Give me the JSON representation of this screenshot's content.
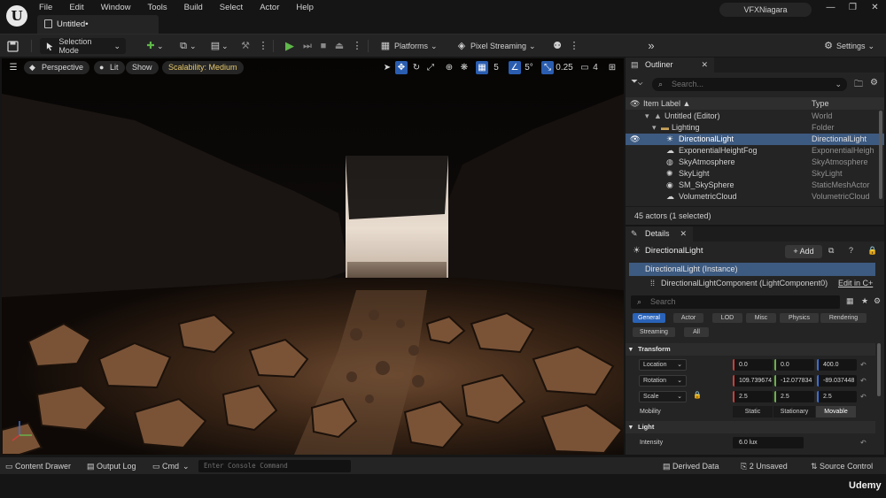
{
  "app": {
    "logo": "U",
    "menu": [
      "File",
      "Edit",
      "Window",
      "Tools",
      "Build",
      "Select",
      "Actor",
      "Help"
    ],
    "document_tab": "Untitled•",
    "project_name": "VFXNiagara",
    "window_controls": [
      "—",
      "❐",
      "✕"
    ]
  },
  "toolbar": {
    "save_icon": "save-icon",
    "selection_mode": "Selection Mode",
    "platforms": "Platforms",
    "pixel_streaming": "Pixel Streaming",
    "settings": "Settings"
  },
  "viewport": {
    "perspective": "Perspective",
    "lit": "Lit",
    "show": "Show",
    "scalability": "Scalability: Medium",
    "grid_snap": "5",
    "angle_snap": "5°",
    "scale_snap": "0.25",
    "camera_speed": "4"
  },
  "outliner": {
    "tab_label": "Outliner",
    "search_placeholder": "Search...",
    "col_label": "Item Label ▲",
    "col_type": "Type",
    "rows": [
      {
        "name": "Untitled (Editor)",
        "type": "World"
      },
      {
        "name": "Lighting",
        "type": "Folder"
      },
      {
        "name": "DirectionalLight",
        "type": "DirectionalLight"
      },
      {
        "name": "ExponentialHeightFog",
        "type": "ExponentialHeigh"
      },
      {
        "name": "SkyAtmosphere",
        "type": "SkyAtmosphere"
      },
      {
        "name": "SkyLight",
        "type": "SkyLight"
      },
      {
        "name": "SM_SkySphere",
        "type": "StaticMeshActor"
      },
      {
        "name": "VolumetricCloud",
        "type": "VolumetricCloud"
      }
    ],
    "status": "45 actors (1 selected)"
  },
  "details": {
    "tab_label": "Details",
    "actor_name": "DirectionalLight",
    "add_label": "+ Add",
    "instance": "DirectionalLight (Instance)",
    "component": "DirectionalLightComponent (LightComponent0)",
    "edit_cpp": "Edit in C+",
    "search_placeholder": "Search",
    "categories": [
      "General",
      "Actor",
      "LOD",
      "Misc",
      "Physics",
      "Rendering",
      "Streaming",
      "All"
    ],
    "transform_section": "Transform",
    "location_label": "Location",
    "location": [
      "0.0",
      "0.0",
      "400.0"
    ],
    "rotation_label": "Rotation",
    "rotation": [
      "109.739674",
      "-12.077834",
      "-89.037448"
    ],
    "scale_label": "Scale",
    "scale": [
      "2.5",
      "2.5",
      "2.5"
    ],
    "mobility_label": "Mobility",
    "mobility_options": [
      "Static",
      "Stationary",
      "Movable"
    ],
    "light_section": "Light",
    "intensity_label": "Intensity",
    "intensity": "6.0 lux"
  },
  "statusbar": {
    "content_drawer": "Content Drawer",
    "output_log": "Output Log",
    "cmd": "Cmd",
    "console_placeholder": "Enter Console Command",
    "derived_data": "Derived Data",
    "unsaved": "2 Unsaved",
    "source_control": "Source Control"
  },
  "watermark": "Udemy",
  "colors": {
    "selection_blue": "#3d5a80",
    "accent_blue": "#2a63b8",
    "play_green": "#5fb84a",
    "scalability_yellow": "#e7c96a",
    "axis_x": "#c8403a",
    "axis_y": "#6ab04c",
    "axis_z": "#3b6fd1"
  }
}
